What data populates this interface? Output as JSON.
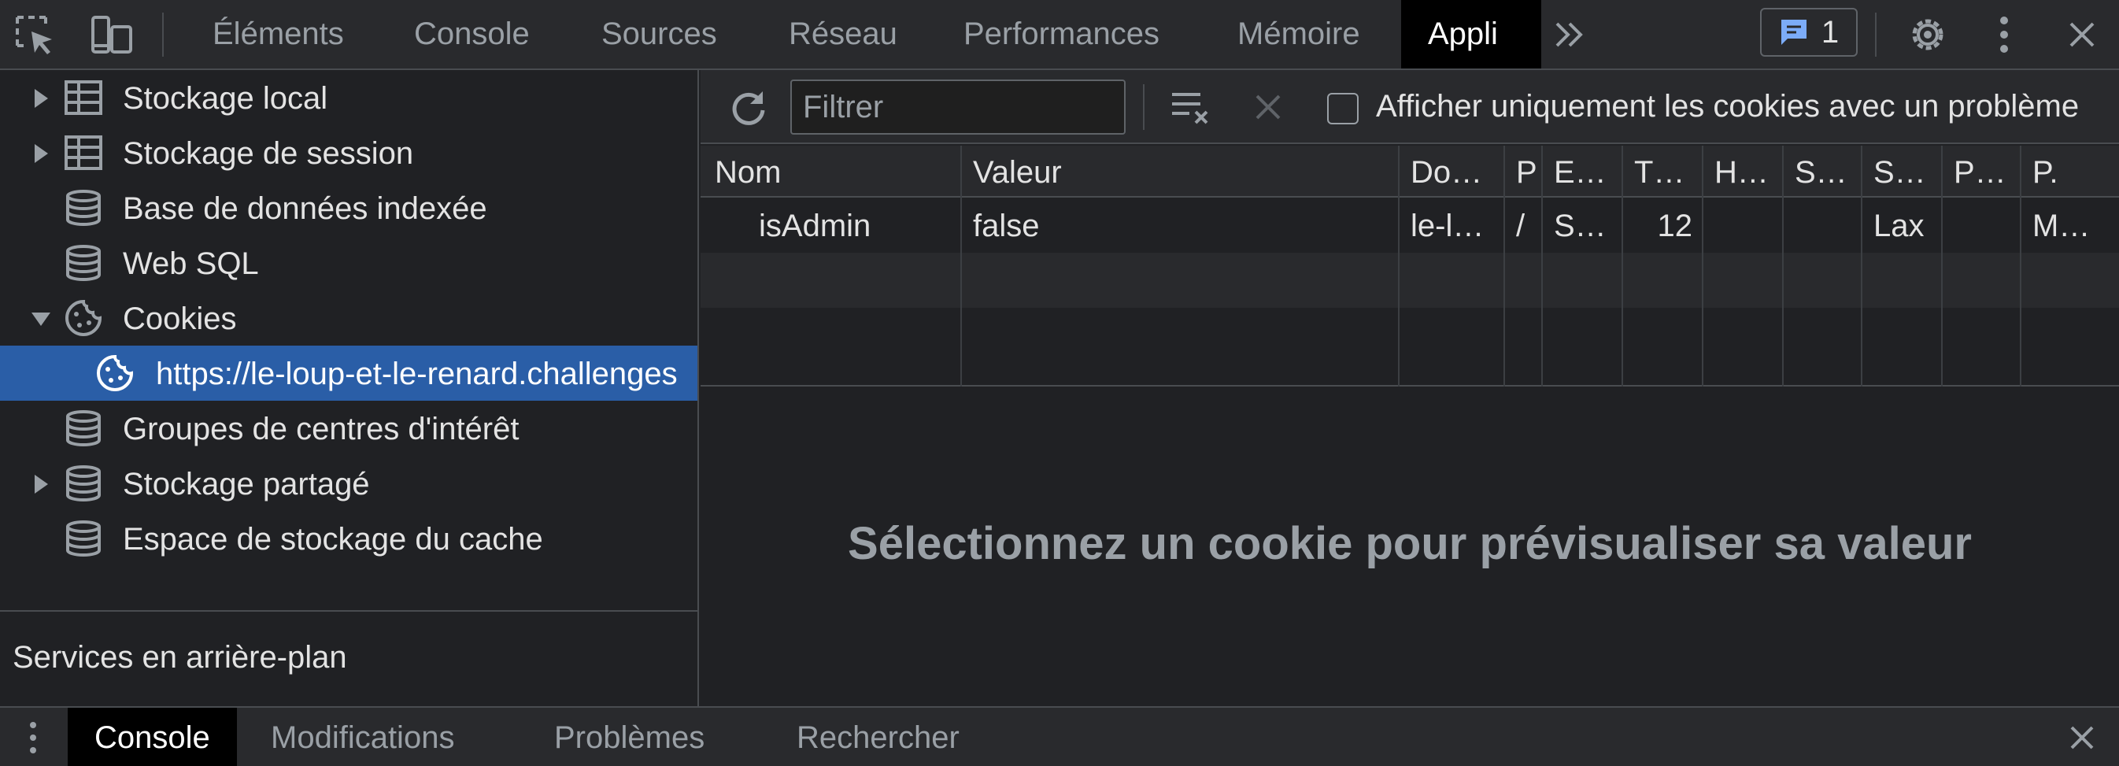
{
  "toolbar": {
    "tabs": [
      "Éléments",
      "Console",
      "Sources",
      "Réseau",
      "Performances",
      "Mémoire",
      "Appli"
    ],
    "active_tab": "Appli",
    "issues_count": "1",
    "icons": [
      "inspect-element-icon",
      "device-toolbar-icon",
      "more-tabs-chevron-icon",
      "chat-issues-icon",
      "settings-gear-icon",
      "kebab-menu-icon",
      "close-icon"
    ]
  },
  "sidebar": {
    "items": [
      {
        "label": "Stockage local",
        "icon": "table-grid-icon",
        "expander": "collapsed"
      },
      {
        "label": "Stockage de session",
        "icon": "table-grid-icon",
        "expander": "collapsed"
      },
      {
        "label": "Base de données indexée",
        "icon": "database-icon",
        "expander": "none"
      },
      {
        "label": "Web SQL",
        "icon": "database-icon",
        "expander": "none"
      },
      {
        "label": "Cookies",
        "icon": "cookie-icon",
        "expander": "expanded"
      },
      {
        "label": "https://le-loup-et-le-renard.challenges",
        "icon": "cookie-icon",
        "expander": "none",
        "selected": true
      },
      {
        "label": "Groupes de centres d'intérêt",
        "icon": "database-icon",
        "expander": "none"
      },
      {
        "label": "Stockage partagé",
        "icon": "database-icon",
        "expander": "collapsed"
      },
      {
        "label": "Espace de stockage du cache",
        "icon": "database-icon",
        "expander": "none"
      }
    ],
    "section_title": "Services en arrière-plan"
  },
  "filterbar": {
    "filter_placeholder": "Filtrer",
    "filter_value": "",
    "checkbox_label": "Afficher uniquement les cookies avec un problème",
    "checkbox_checked": false
  },
  "cookies_table": {
    "columns": [
      "Nom",
      "Valeur",
      "Do…",
      "P",
      "E…",
      "T…",
      "H…",
      "S…",
      "S…",
      "P…",
      "P."
    ],
    "rows": [
      [
        "isAdmin",
        "false",
        "le-l…",
        "/",
        "S…",
        "12",
        "",
        "",
        "Lax",
        "",
        "M…"
      ]
    ]
  },
  "preview": {
    "message": "Sélectionnez un cookie pour prévisualiser sa valeur"
  },
  "drawer": {
    "tabs": [
      "Console",
      "Modifications",
      "Problèmes",
      "Rechercher"
    ],
    "active_tab": "Console"
  },
  "colors": {
    "toolbar_bg": "#292a2d",
    "panel_bg": "#202124",
    "selected_row": "#2a5ea7",
    "active_tab_bg": "#000000",
    "badge_icon": "#7cacf8"
  }
}
